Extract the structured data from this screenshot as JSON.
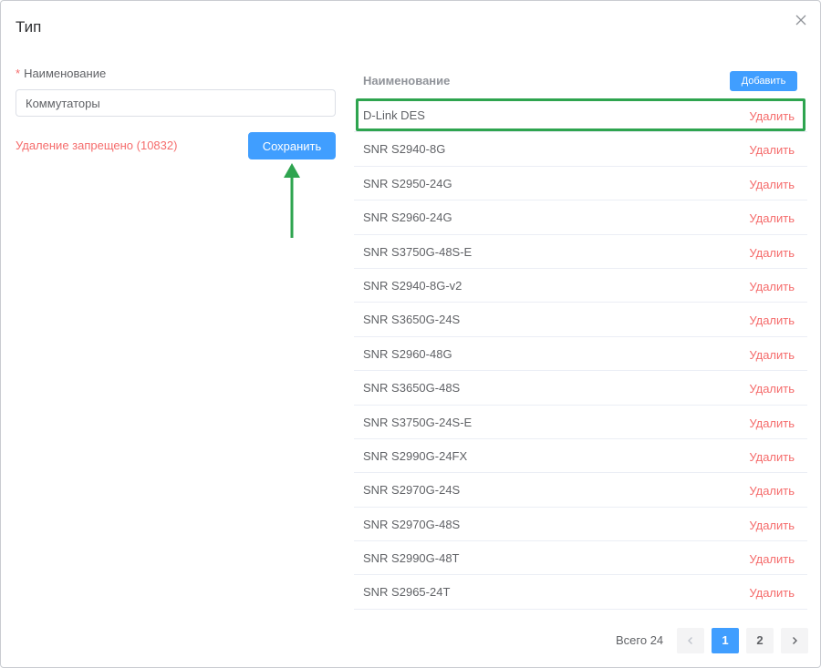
{
  "dialog": {
    "title": "Тип",
    "close_icon": "close-icon"
  },
  "form": {
    "required_mark": "*",
    "name_label": "Наименование",
    "name_value": "Коммутаторы",
    "forbidden_text": "Удаление запрещено (10832)",
    "save_label": "Сохранить"
  },
  "list": {
    "header": "Наименование",
    "add_label": "Добавить",
    "rows": [
      {
        "name": "D-Link DES",
        "action": "Удалить"
      },
      {
        "name": "SNR S2940-8G",
        "action": "Удалить"
      },
      {
        "name": "SNR S2950-24G",
        "action": "Удалить"
      },
      {
        "name": "SNR S2960-24G",
        "action": "Удалить"
      },
      {
        "name": "SNR S3750G-48S-E",
        "action": "Удалить"
      },
      {
        "name": "SNR S2940-8G-v2",
        "action": "Удалить"
      },
      {
        "name": "SNR S3650G-24S",
        "action": "Удалить"
      },
      {
        "name": "SNR S2960-48G",
        "action": "Удалить"
      },
      {
        "name": "SNR S3650G-48S",
        "action": "Удалить"
      },
      {
        "name": "SNR S3750G-24S-E",
        "action": "Удалить"
      },
      {
        "name": "SNR S2990G-24FX",
        "action": "Удалить"
      },
      {
        "name": "SNR S2970G-24S",
        "action": "Удалить"
      },
      {
        "name": "SNR S2970G-48S",
        "action": "Удалить"
      },
      {
        "name": "SNR S2990G-48T",
        "action": "Удалить"
      },
      {
        "name": "SNR S2965-24T",
        "action": "Удалить"
      }
    ]
  },
  "pagination": {
    "total": "Всего 24",
    "pages": [
      "1",
      "2"
    ],
    "current_page": "1",
    "prev_icon": "chevron-left-icon",
    "next_icon": "chevron-right-icon"
  },
  "colors": {
    "primary": "#409eff",
    "danger": "#f56c6c",
    "highlight": "#2ea44f"
  }
}
